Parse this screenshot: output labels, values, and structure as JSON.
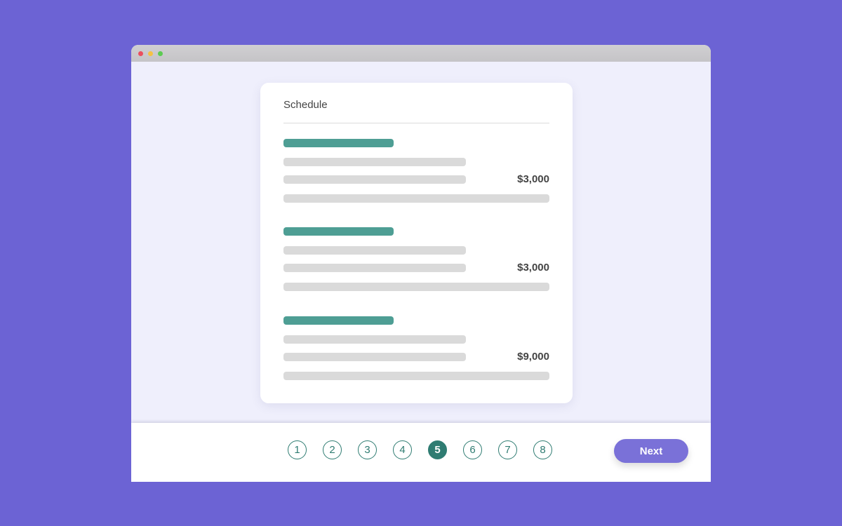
{
  "window": {
    "controls": [
      "close",
      "minimize",
      "maximize"
    ]
  },
  "card": {
    "title": "Schedule",
    "sections": [
      {
        "amount": "$3,000"
      },
      {
        "amount": "$3,000"
      },
      {
        "amount": "$9,000"
      }
    ]
  },
  "footer": {
    "pages": [
      "1",
      "2",
      "3",
      "4",
      "5",
      "6",
      "7",
      "8"
    ],
    "current_page": "5",
    "next_label": "Next"
  },
  "colors": {
    "background": "#6C63D4",
    "accent_teal": "#4E9E94",
    "page_active": "#2F7C72",
    "button": "#7A71D8"
  }
}
